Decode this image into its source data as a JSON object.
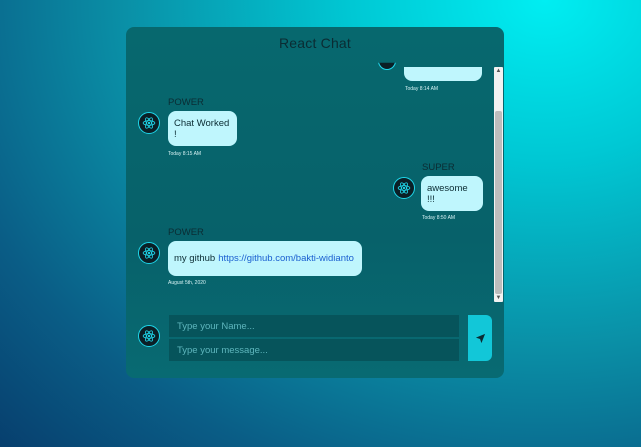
{
  "app": {
    "title": "React Chat"
  },
  "messages": [
    {
      "sender": "",
      "text": "",
      "time": "Today 8:14 AM",
      "side": "right"
    },
    {
      "sender": "POWER",
      "text": "Chat Worked !",
      "time": "Today 8:15 AM",
      "side": "left"
    },
    {
      "sender": "SUPER",
      "text": "awesome !!!",
      "time": "Today 8:50 AM",
      "side": "right"
    },
    {
      "sender": "POWER",
      "text": "my github",
      "link": "https://github.com/bakti-widianto",
      "time": "August 5th, 2020",
      "side": "left"
    }
  ],
  "composer": {
    "name_placeholder": "Type your Name...",
    "message_placeholder": "Type your message...",
    "send_icon": "send-arrow-icon"
  },
  "icons": {
    "avatar": "react-atom-icon"
  },
  "colors": {
    "accent": "#12c7d8",
    "bubble": "#bff6fd",
    "avatar_ring": "#1fd6ea"
  }
}
